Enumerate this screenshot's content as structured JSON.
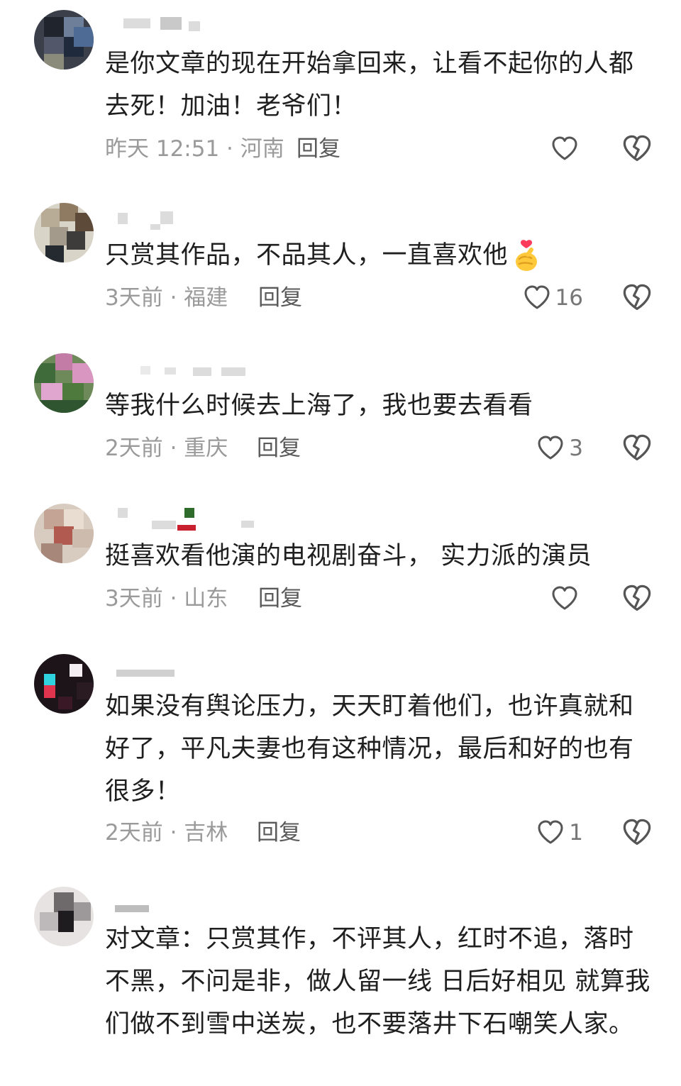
{
  "comments": [
    {
      "text": "是你文章的现在开始拿回来，让看不起你的人都去死！加油！老爷们！",
      "time": "昨天 12:51",
      "location": "河南",
      "meta": "昨天 12:51 · 河南",
      "reply": "回复",
      "likes": ""
    },
    {
      "text": "只赏其作品，不品其人，一直喜欢他",
      "time": "3天前",
      "location": "福建",
      "meta": "3天前 · 福建",
      "reply": "回复",
      "likes": "16",
      "emoji": "finger-heart-emoji"
    },
    {
      "text": "等我什么时候去上海了，我也要去看看",
      "time": "2天前",
      "location": "重庆",
      "meta": "2天前 · 重庆",
      "reply": "回复",
      "likes": "3"
    },
    {
      "text": "挺喜欢看他演的电视剧奋斗， 实力派的演员",
      "time": "3天前",
      "location": "山东",
      "meta": "3天前 · 山东",
      "reply": "回复",
      "likes": ""
    },
    {
      "text": "如果没有舆论压力，天天盯着他们，也许真就和好了，平凡夫妻也有这种情况，最后和好的也有很多！",
      "time": "2天前",
      "location": "吉林",
      "meta": "2天前 · 吉林",
      "reply": "回复",
      "likes": "1"
    },
    {
      "text": "对文章：只赏其作，不评其人，红时不追，落时不黑，不问是非，做人留一线 日后好相见 就算我们做不到雪中送炭，也不要落井下石嘲笑人家。",
      "time": "",
      "location": "",
      "meta": "",
      "reply": "",
      "likes": ""
    }
  ],
  "icons": {
    "like": "heart-outline-icon",
    "dislike": "broken-heart-outline-icon"
  },
  "colors": {
    "text": "#1f1f1f",
    "meta": "#9a9a9a",
    "reply": "#5a5a5a",
    "icon": "#555555"
  }
}
